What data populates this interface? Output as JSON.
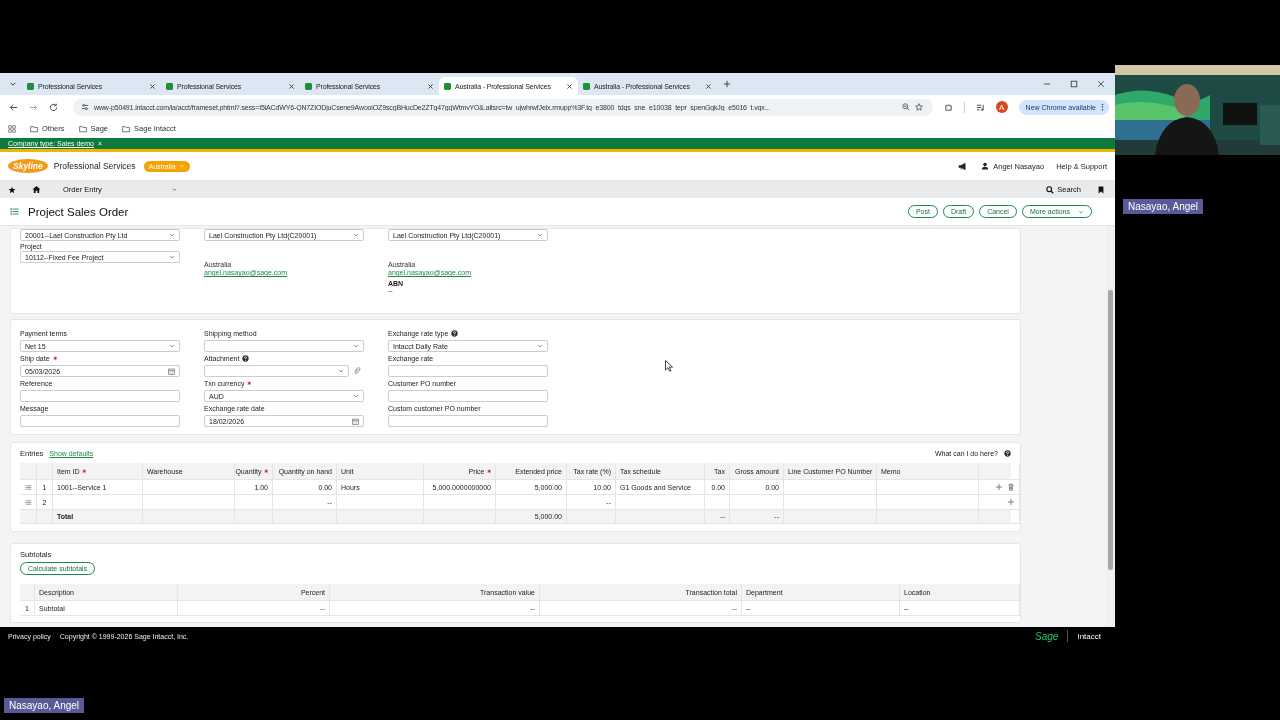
{
  "browser": {
    "tabs": [
      {
        "title": "Professional Services",
        "selected": false
      },
      {
        "title": "Professional Services",
        "selected": false
      },
      {
        "title": "Professional Services",
        "selected": false
      },
      {
        "title": "Australia - Professional Services",
        "selected": true
      },
      {
        "title": "Australia - Professional Services",
        "selected": false
      }
    ],
    "url": "www-p50491.intacct.com/ia/acct/frameset.phtml?.sess=I5lACdWY6-QN7ZIODjuCsene9AwooiOZ9scgBHucDe2ZTg47gqWtmvYO&.altsrc=tw_ujwhrwfJelx.rmupp%3F.tq_e3800_tdqs_sne_e10038_tepr_spenGgkJg_e5016_t.vgx...",
    "profile_initial": "A",
    "update_button": "New Chrome available",
    "bookmarks": [
      "Others",
      "Sage",
      "Sage Intacct"
    ]
  },
  "company_banner": {
    "text": "Company type: Sales demo",
    "close": "×"
  },
  "header": {
    "logo": "Skyline",
    "app_name": "Professional Services",
    "entity": "Australia",
    "user": "Angel Nasayao",
    "help": "Help & Support"
  },
  "nav": {
    "module": "Order Entry",
    "search": "Search"
  },
  "page": {
    "title": "Project Sales Order",
    "actions": [
      "Post",
      "Draft",
      "Cancel",
      "More actions"
    ]
  },
  "customer_section": {
    "columns": [
      [
        {
          "kind": "select",
          "value": "20001--Lael Construction Pty Ltd"
        },
        {
          "kind": "select",
          "label": "Project",
          "value": "10112--Fixed Fee Project"
        }
      ],
      [
        {
          "kind": "select",
          "value": "Lael Construction Pty Ltd(C20001)"
        },
        {
          "kind": "text",
          "value": "Australia"
        },
        {
          "kind": "link",
          "value": "angel.nasayao@sage.com"
        }
      ],
      [
        {
          "kind": "select",
          "value": "Lael Construction Pty Ltd(C20001)"
        },
        {
          "kind": "text",
          "value": "Australia"
        },
        {
          "kind": "link",
          "value": "angel.nasayao@sage.com"
        },
        {
          "kind": "heading",
          "value": "ABN"
        },
        {
          "kind": "text",
          "value": "--"
        }
      ]
    ]
  },
  "details_section": {
    "fields": [
      {
        "label": "Payment terms",
        "kind": "select",
        "required": false,
        "help": false,
        "value": "Net 15"
      },
      {
        "label": "Shipping method",
        "kind": "select",
        "required": false,
        "help": false
      },
      {
        "label": "Exchange rate type",
        "kind": "select",
        "required": false,
        "help": true,
        "value": "Intacct Daily Rate"
      },
      {
        "label": "Ship date",
        "kind": "date",
        "required": true,
        "help": false,
        "value": "05/03/2026"
      },
      {
        "label": "Attachment",
        "kind": "attachment",
        "required": false,
        "help": true
      },
      {
        "label": "Exchange rate",
        "kind": "input",
        "required": false,
        "help": false
      },
      {
        "label": "Reference",
        "kind": "input",
        "required": false,
        "help": false
      },
      {
        "label": "Txn currency",
        "kind": "select",
        "required": true,
        "help": false,
        "value": "AUD"
      },
      {
        "label": "Customer PO number",
        "kind": "input",
        "required": false,
        "help": false
      },
      {
        "label": "Message",
        "kind": "input",
        "required": false,
        "help": false
      },
      {
        "label": "Exchange rate date",
        "kind": "date",
        "required": false,
        "help": false,
        "value": "18/02/2026"
      },
      {
        "label": "Custom customer PO number",
        "kind": "input",
        "required": false,
        "help": false
      }
    ]
  },
  "entries": {
    "title": "Entries",
    "defaults_link": "Show defaults",
    "help_link": "What can I do here?",
    "columns": [
      {
        "label": "Item ID",
        "required": true,
        "numeric": false
      },
      {
        "label": "Warehouse",
        "required": false,
        "numeric": false
      },
      {
        "label": "Quantity",
        "required": true,
        "numeric": true
      },
      {
        "label": "Quantity on hand",
        "required": false,
        "numeric": true
      },
      {
        "label": "Unit",
        "required": false,
        "numeric": false
      },
      {
        "label": "Price",
        "required": true,
        "numeric": true
      },
      {
        "label": "Extended price",
        "required": false,
        "numeric": true
      },
      {
        "label": "Tax rate (%)",
        "required": false,
        "numeric": true
      },
      {
        "label": "Tax schedule",
        "required": false,
        "numeric": false
      },
      {
        "label": "Tax",
        "required": false,
        "numeric": true
      },
      {
        "label": "Gross amount",
        "required": false,
        "numeric": true
      },
      {
        "label": "Line Customer PO Number",
        "required": false,
        "numeric": false
      },
      {
        "label": "Memo",
        "required": false,
        "numeric": false
      }
    ],
    "rows": [
      {
        "number": "1",
        "deletable": true,
        "cells": [
          "1001--Service 1",
          null,
          "1.00",
          "0.00",
          "Hours",
          "5,000.0000000000",
          "5,000.00",
          "10.00",
          "G1 Goods and Service",
          "0.00",
          "0.00",
          null,
          null
        ]
      },
      {
        "number": "2",
        "deletable": false,
        "cells": [
          null,
          null,
          null,
          "--",
          null,
          null,
          null,
          "--",
          null,
          null,
          null,
          null,
          null
        ]
      }
    ],
    "total": {
      "cells": [
        "Total",
        null,
        null,
        null,
        null,
        null,
        "5,000.00",
        null,
        null,
        "--",
        "--",
        null,
        null
      ]
    }
  },
  "subtotals": {
    "title": "Subtotals",
    "button": "Calculate subtotals",
    "columns": [
      {
        "label": "Description",
        "numeric": false
      },
      {
        "label": "Percent",
        "numeric": true
      },
      {
        "label": "Transaction value",
        "numeric": true
      },
      {
        "label": "Transaction total",
        "numeric": true
      },
      {
        "label": "Department",
        "numeric": false
      },
      {
        "label": "Location",
        "numeric": false
      }
    ],
    "rows": [
      {
        "number": "1",
        "cells": [
          "Subtotal",
          "--",
          "--",
          "--",
          "--",
          "--"
        ]
      }
    ]
  },
  "footer": {
    "privacy": "Privacy policy",
    "copyright": "Copyright © 1999-2026 Sage Intacct, Inc.",
    "brand": "Sage",
    "product": "Intacct"
  },
  "webcam": {
    "kind": "picture"
  },
  "name_tags": [
    "Nasayao, Angel",
    "Nasayao, Angel"
  ]
}
